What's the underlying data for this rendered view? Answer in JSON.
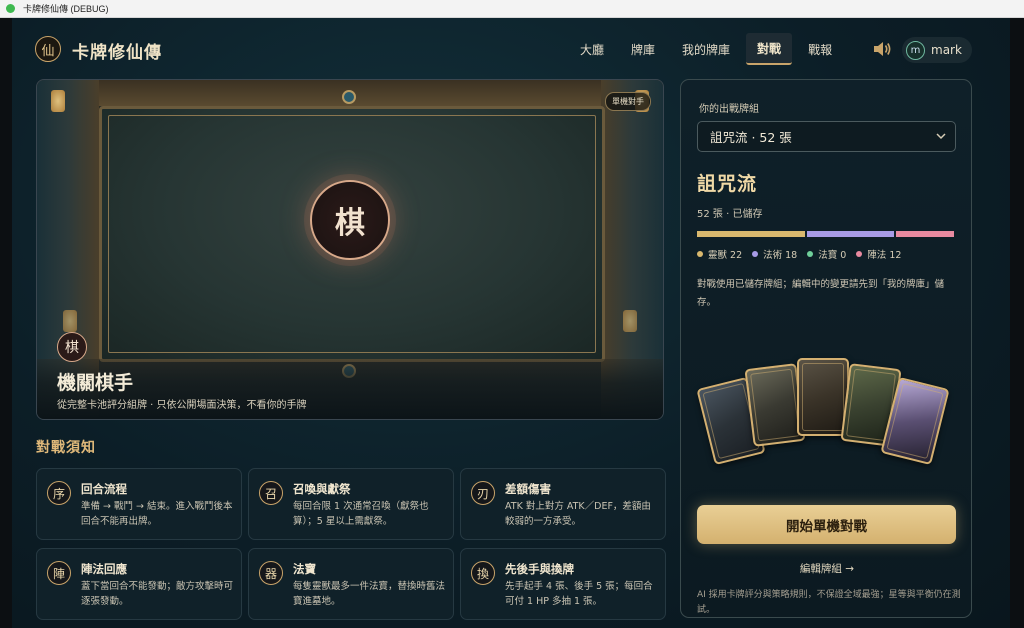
{
  "window": {
    "title": "卡牌修仙傳 (DEBUG)"
  },
  "header": {
    "logo_glyph": "仙",
    "app_name": "卡牌修仙傳",
    "nav": [
      {
        "label": "大廳",
        "active": false
      },
      {
        "label": "牌庫",
        "active": false
      },
      {
        "label": "我的牌庫",
        "active": false
      },
      {
        "label": "對戰",
        "active": true
      },
      {
        "label": "戰報",
        "active": false
      }
    ],
    "user": {
      "avatar_initial": "m",
      "name": "mark"
    }
  },
  "board": {
    "mode_tag": "單機對手",
    "center_glyph": "棋",
    "opponent": {
      "glyph": "棋",
      "name": "機關棋手",
      "description": "從完整卡池評分組牌 · 只依公開場面決策，不看你的手牌"
    }
  },
  "rules": {
    "title": "對戰須知",
    "cards": [
      {
        "icon_glyph": "序",
        "title": "回合流程",
        "text": "準備 → 戰鬥 → 結束。進入戰鬥後本回合不能再出牌。"
      },
      {
        "icon_glyph": "召",
        "title": "召喚與獻祭",
        "text": "每回合限 1 次通常召喚（獻祭也算）；5 星以上需獻祭。"
      },
      {
        "icon_glyph": "刃",
        "title": "差額傷害",
        "text": "ATK 對上對方 ATK／DEF，差額由較弱的一方承受。"
      },
      {
        "icon_glyph": "陣",
        "title": "陣法回應",
        "text": "蓋下當回合不能發動；敵方攻擊時可逐張發動。"
      },
      {
        "icon_glyph": "器",
        "title": "法寶",
        "text": "每隻靈獸最多一件法寶，替換時舊法寶進墓地。"
      },
      {
        "icon_glyph": "換",
        "title": "先後手與換牌",
        "text": "先手起手 4 張、後手 5 張；每回合可付 1 HP 多抽 1 張。"
      }
    ]
  },
  "panel": {
    "deck_label": "你的出戰牌組",
    "selected_deck": "詛咒流 · 52 張",
    "deck_name": "詛咒流",
    "deck_meta": "52 張 · 已儲存",
    "composition": [
      {
        "label": "靈獸 22",
        "count": 22,
        "color": "#d9b86e"
      },
      {
        "label": "法術 18",
        "count": 18,
        "color": "#a79be6"
      },
      {
        "label": "法寶 0",
        "count": 0,
        "color": "#6fcf9a"
      },
      {
        "label": "陣法 12",
        "count": 12,
        "color": "#e88aa0"
      }
    ],
    "note": "對戰使用已儲存牌組；編輯中的變更請先到「我的牌庫」儲存。",
    "start_button": "開始單機對戰",
    "edit_link": "編輯牌組 →",
    "ai_note": "AI 採用卡牌評分與策略規則，不保證全域最強；星等與平衡仍在測試。"
  }
}
